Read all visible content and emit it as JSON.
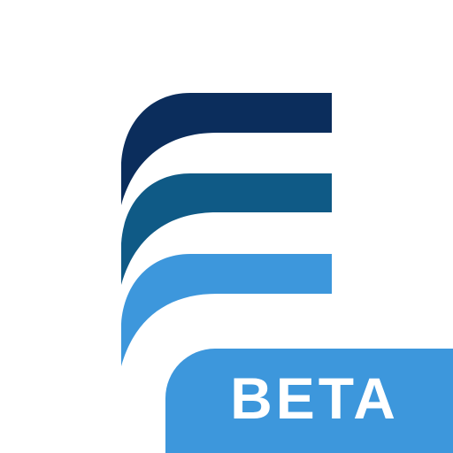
{
  "app_icon": {
    "logo_icon": "stacked-waves-e-logo-icon",
    "colors": {
      "background": "#ffffff",
      "stripe_top": "#0b2d5c",
      "stripe_middle": "#0f5a86",
      "stripe_bottom": "#3d97dc",
      "badge": "#3d97dc",
      "badge_text": "#ffffff"
    },
    "badge": {
      "label": "BETA"
    }
  }
}
